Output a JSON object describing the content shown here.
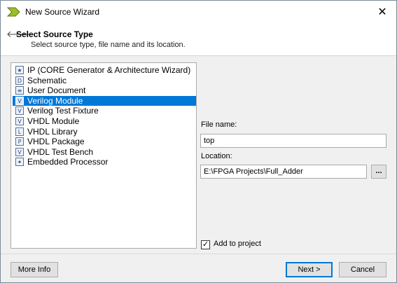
{
  "window": {
    "title": "New Source Wizard",
    "close_glyph": "✕"
  },
  "header": {
    "back_glyph": "🡐",
    "title": "Select Source Type",
    "subtitle": "Select source type, file name and its location."
  },
  "source_types": [
    {
      "label": "IP (CORE Generator & Architecture Wizard)",
      "icon": "ip-core-icon",
      "glyph": "★",
      "selected": false
    },
    {
      "label": "Schematic",
      "icon": "schematic-icon",
      "glyph": "D",
      "selected": false
    },
    {
      "label": "User Document",
      "icon": "document-icon",
      "glyph": "≡",
      "selected": false
    },
    {
      "label": "Verilog Module",
      "icon": "verilog-module-icon",
      "glyph": "V",
      "selected": true
    },
    {
      "label": "Verilog Test Fixture",
      "icon": "verilog-test-icon",
      "glyph": "V",
      "selected": false
    },
    {
      "label": "VHDL Module",
      "icon": "vhdl-module-icon",
      "glyph": "V",
      "selected": false
    },
    {
      "label": "VHDL Library",
      "icon": "vhdl-library-icon",
      "glyph": "L",
      "selected": false
    },
    {
      "label": "VHDL Package",
      "icon": "vhdl-package-icon",
      "glyph": "P",
      "selected": false
    },
    {
      "label": "VHDL Test Bench",
      "icon": "vhdl-testbench-icon",
      "glyph": "V",
      "selected": false
    },
    {
      "label": "Embedded Processor",
      "icon": "embedded-processor-icon",
      "glyph": "✦",
      "selected": false
    }
  ],
  "file_name": {
    "label": "File name:",
    "value": "top"
  },
  "location": {
    "label": "Location:",
    "value": "E:\\FPGA Projects\\Full_Adder",
    "browse_label": "..."
  },
  "add_to_project": {
    "label": "Add to project",
    "checked": true,
    "check_glyph": "✓"
  },
  "buttons": {
    "more_info": "More Info",
    "next": "Next >",
    "cancel": "Cancel"
  },
  "colors": {
    "selection": "#0078d7",
    "body_bg": "#f0f0f0",
    "accent": "#0078d7"
  }
}
